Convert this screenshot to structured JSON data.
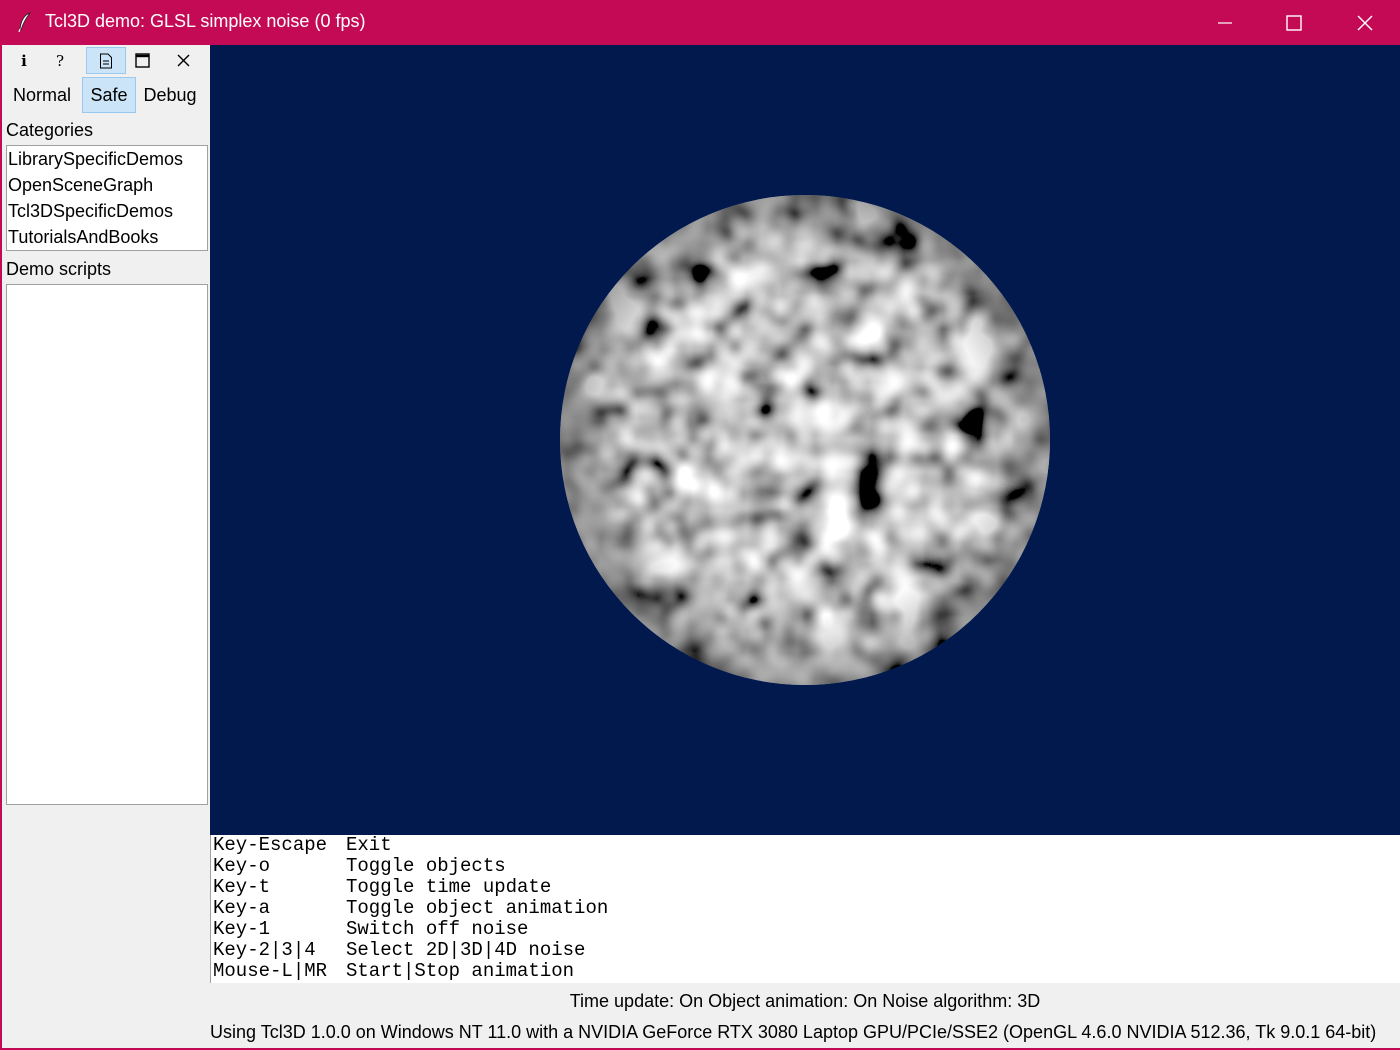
{
  "window": {
    "title": "Tcl3D demo: GLSL simplex noise (0 fps)",
    "accent_color": "#c50a55",
    "controls": [
      "minimize-icon",
      "maximize-icon",
      "close-icon"
    ]
  },
  "toolbar": {
    "tools": [
      {
        "glyph": "i",
        "icon": "info-icon"
      },
      {
        "glyph": "?",
        "icon": "help-icon"
      },
      {
        "glyph": "",
        "icon": "document-icon",
        "active": true
      },
      {
        "glyph": "",
        "icon": "fullscreen-icon"
      },
      {
        "glyph": "",
        "icon": "close-icon"
      }
    ],
    "modes": [
      {
        "label": "Normal"
      },
      {
        "label": "Safe",
        "active": true
      },
      {
        "label": "Debug"
      }
    ]
  },
  "categories": {
    "label": "Categories",
    "items": [
      "LibrarySpecificDemos",
      "OpenSceneGraph",
      "Tcl3DSpecificDemos",
      "TutorialsAndBooks"
    ]
  },
  "demo_scripts": {
    "label": "Demo scripts",
    "items": []
  },
  "viewport": {
    "background": "#02194d",
    "object": "noise-textured sphere"
  },
  "help": {
    "lines": [
      {
        "key": "Key-Escape",
        "action": "Exit"
      },
      {
        "key": "Key-o",
        "action": "Toggle objects"
      },
      {
        "key": "Key-t",
        "action": "Toggle time update"
      },
      {
        "key": "Key-a",
        "action": "Toggle object animation"
      },
      {
        "key": "Key-1",
        "action": "Switch off noise"
      },
      {
        "key": "Key-2|3|4",
        "action": "Select 2D|3D|4D noise"
      },
      {
        "key": "Mouse-L|MR",
        "action": "Start|Stop animation"
      }
    ]
  },
  "status": {
    "state": "Time update: On Object animation: On Noise algorithm: 3D",
    "info": "Using Tcl3D 1.0.0 on Windows NT 11.0 with a NVIDIA GeForce RTX 3080 Laptop GPU/PCIe/SSE2 (OpenGL 4.6.0 NVIDIA 512.36, Tk 9.0.1 64-bit)"
  }
}
